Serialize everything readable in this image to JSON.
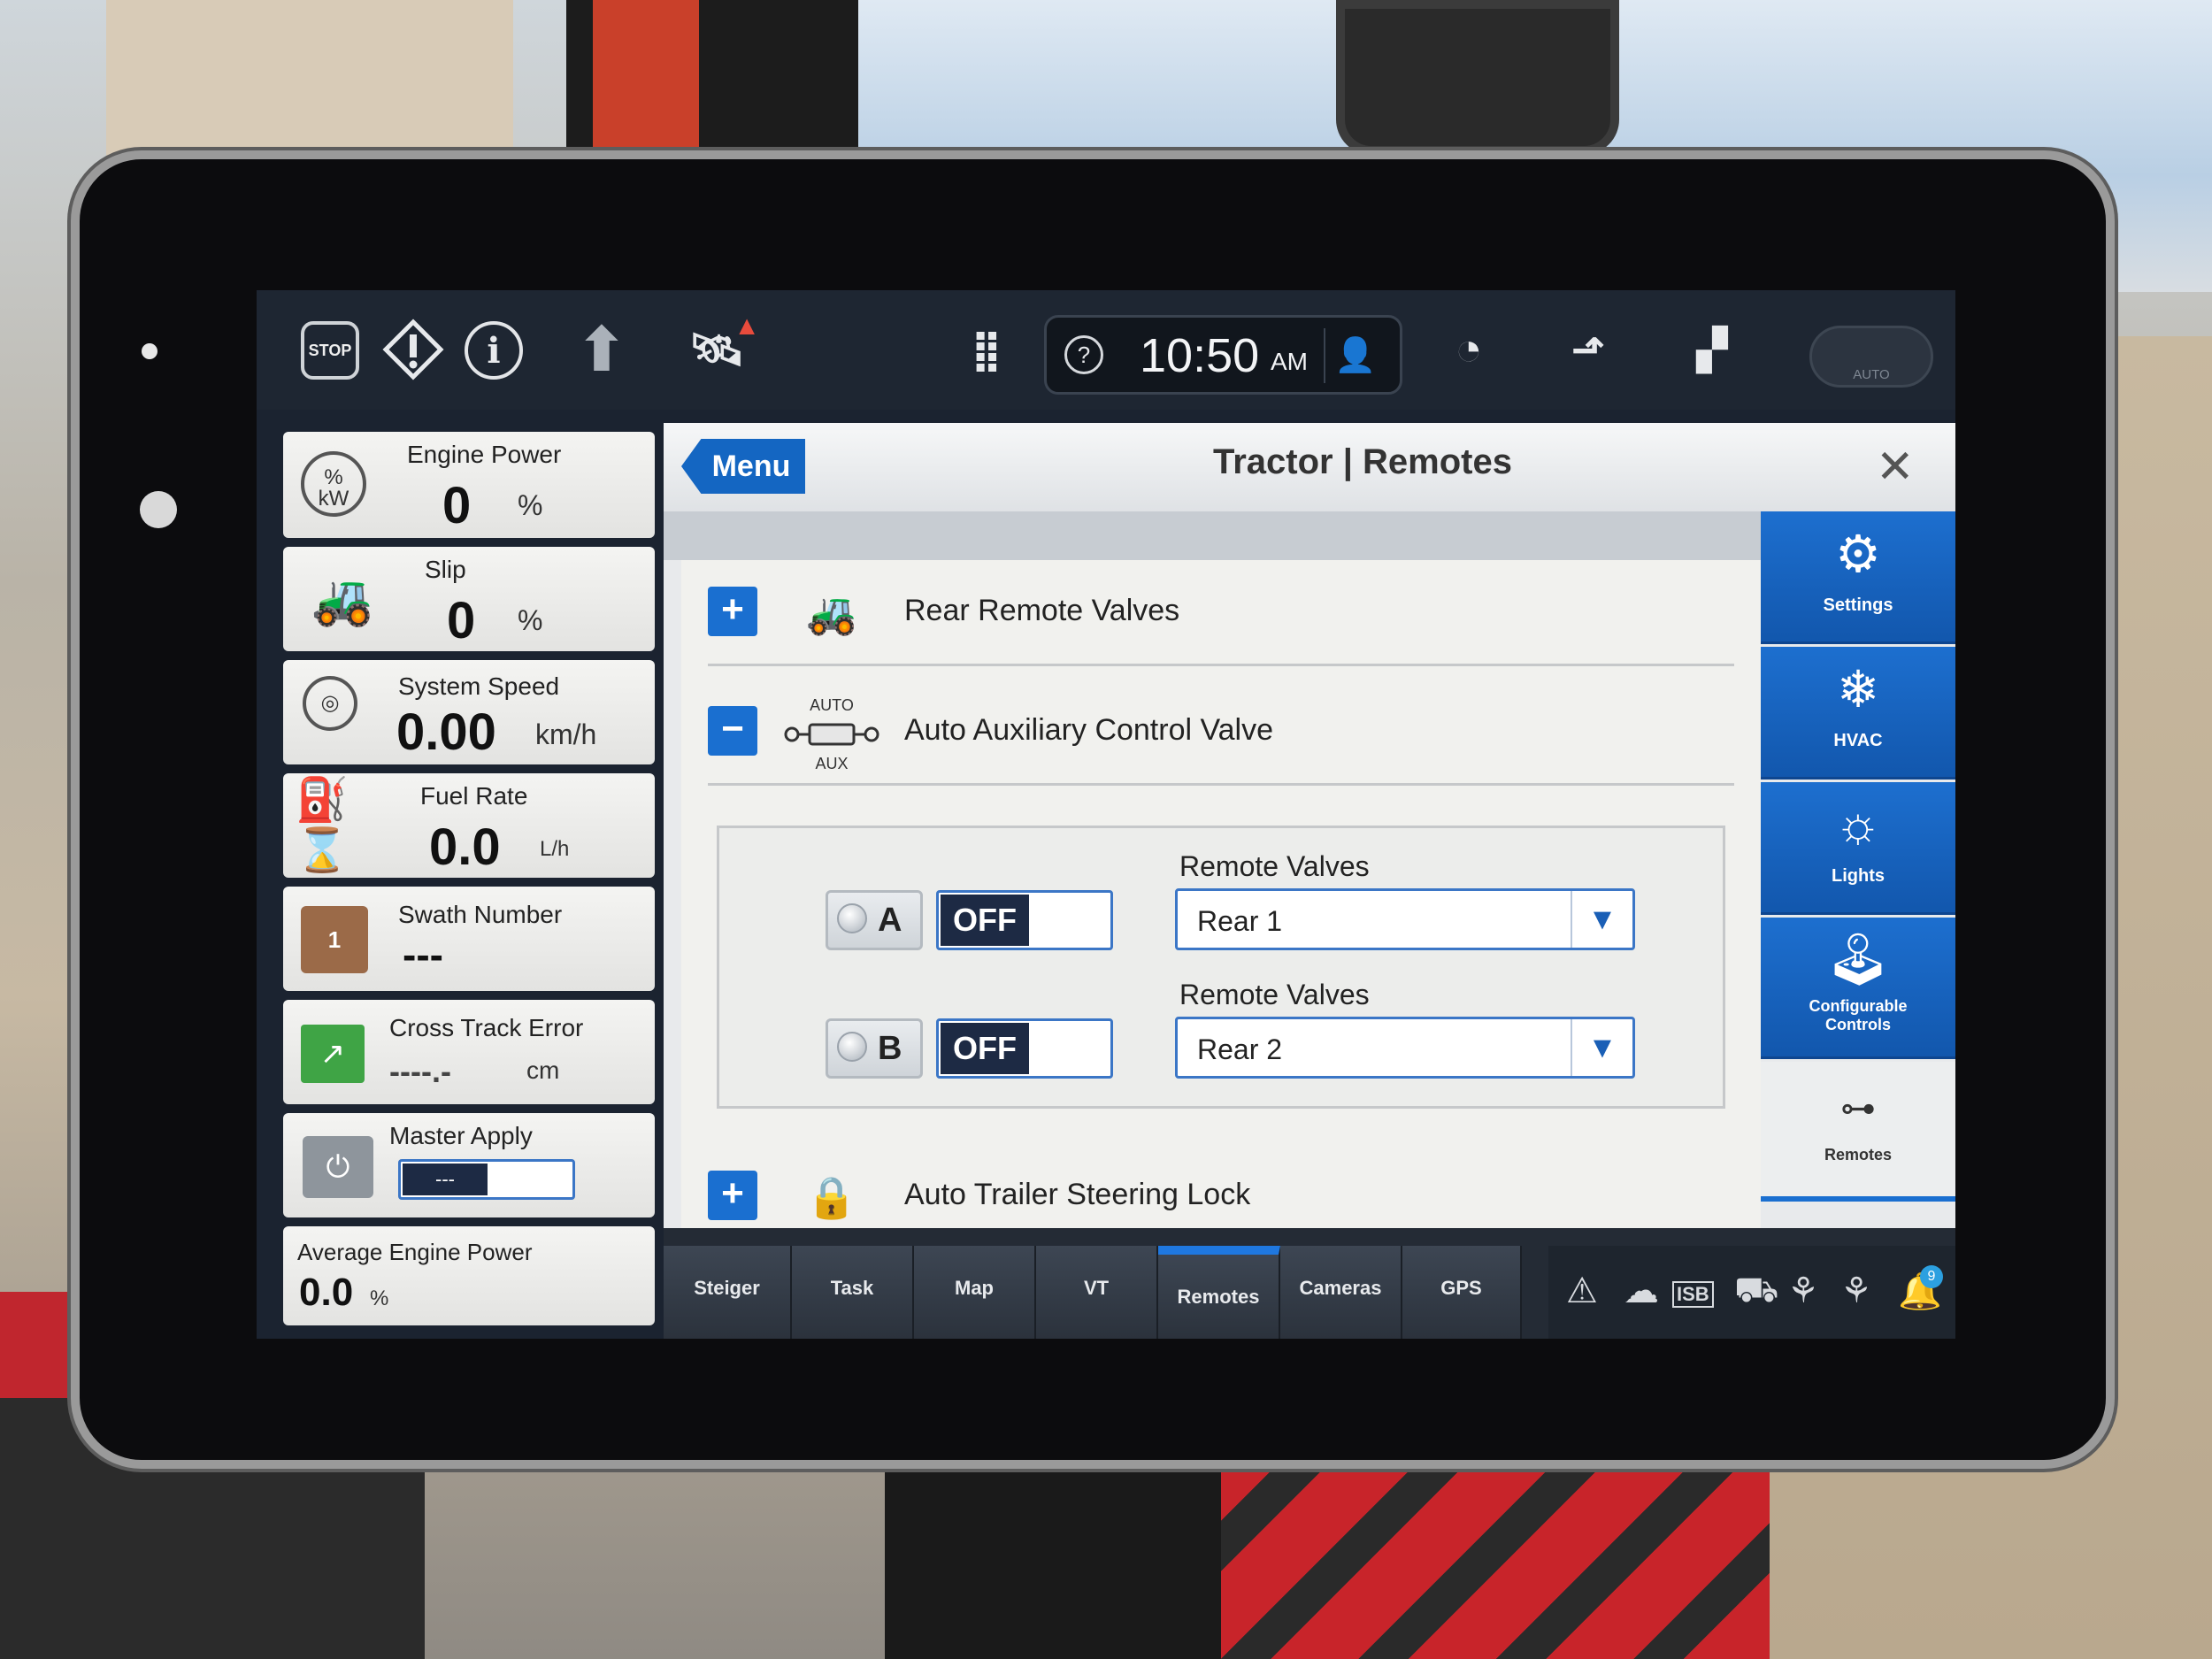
{
  "topbar": {
    "stop_label": "STOP",
    "warning_icon": "warning-diamond-icon",
    "info_glyph": "i",
    "up_glyph": "⬆",
    "sat_glyph": "🛰",
    "alert_glyph": "▲",
    "apps_glyph": "⣿",
    "help_glyph": "?",
    "time": "10:50",
    "ampm": "AM",
    "user_glyph": "👤",
    "gauge_glyph": "◔",
    "turn_glyph": "⬏",
    "field_glyph": "▞",
    "auto_label": "AUTO"
  },
  "widgets": {
    "engine_power": {
      "title": "Engine Power",
      "value": "0",
      "unit": "%",
      "icon_text": "%\nkW"
    },
    "slip": {
      "title": "Slip",
      "value": "0",
      "unit": "%"
    },
    "system_speed": {
      "title": "System Speed",
      "value": "0.00",
      "unit": "km/h"
    },
    "fuel_rate": {
      "title": "Fuel Rate",
      "value": "0.0",
      "unit": "L/h"
    },
    "swath_number": {
      "title": "Swath Number",
      "value": "---",
      "icon_text": "1"
    },
    "cross_track_error": {
      "title": "Cross Track Error",
      "value": "----.-",
      "unit": "cm"
    },
    "master_apply": {
      "title": "Master Apply",
      "value": "---"
    },
    "average_engine_power": {
      "title": "Average Engine Power",
      "value": "0.0",
      "unit": "%"
    }
  },
  "panel": {
    "menu_label": "Menu",
    "title": "Tractor | Remotes",
    "close_glyph": "✕",
    "rows": {
      "rear_remote_valves": {
        "toggle": "+",
        "label": "Rear Remote Valves"
      },
      "auto_aux": {
        "toggle": "−",
        "label": "Auto Auxiliary Control Valve",
        "icon_top": "AUTO",
        "icon_bottom": "AUX"
      },
      "auto_trailer": {
        "toggle": "+",
        "label": "Auto Trailer Steering Lock"
      }
    },
    "valves": {
      "a": {
        "letter": "A",
        "state": "OFF",
        "select_label": "Remote Valves",
        "selected": "Rear 1"
      },
      "b": {
        "letter": "B",
        "state": "OFF",
        "select_label": "Remote Valves",
        "selected": "Rear 2"
      }
    }
  },
  "sidenav": {
    "settings": "Settings",
    "hvac": "HVAC",
    "lights": "Lights",
    "configurable": "Configurable Controls",
    "remotes": "Remotes"
  },
  "tabs": [
    "Steiger",
    "Task",
    "Map",
    "VT",
    "Remotes",
    "Cameras",
    "GPS"
  ],
  "status": {
    "notification_count": "9",
    "isb_label": "ISB"
  },
  "colors": {
    "accent_blue": "#1a6fd0",
    "toggle_dark": "#1d2a44"
  }
}
